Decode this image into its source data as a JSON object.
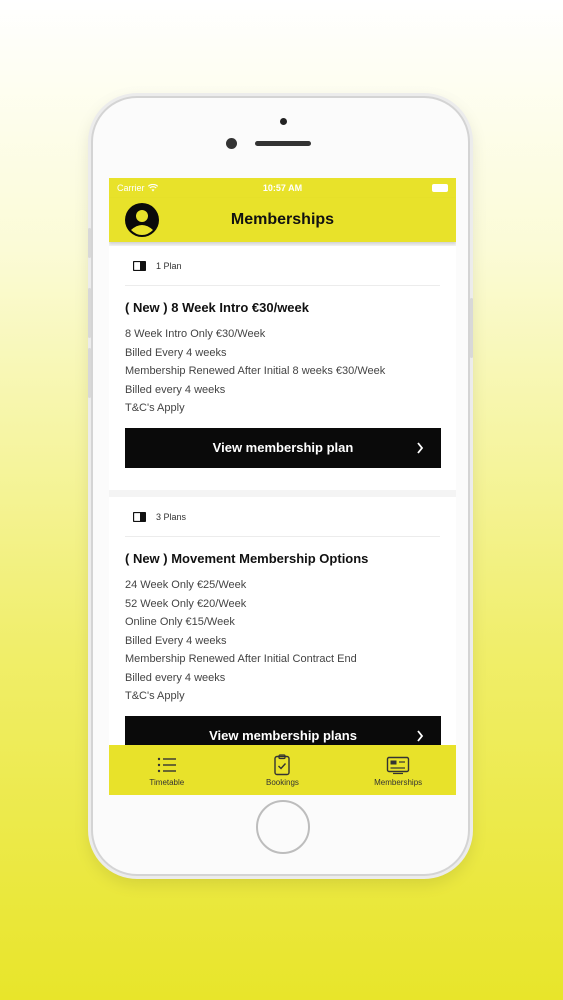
{
  "status_bar": {
    "carrier": "Carrier",
    "time": "10:57 AM"
  },
  "header": {
    "title": "Memberships"
  },
  "cards": [
    {
      "plan_count": "1 Plan",
      "title": "( New ) 8 Week Intro €30/week",
      "lines": [
        "8 Week Intro Only €30/Week",
        "Billed Every 4 weeks",
        "Membership Renewed After Initial 8 weeks €30/Week",
        "Billed every 4 weeks",
        "T&C's Apply"
      ],
      "button_label": "View membership plan"
    },
    {
      "plan_count": "3 Plans",
      "title": "( New ) Movement Membership Options",
      "lines": [
        "24 Week Only €25/Week",
        "52 Week Only €20/Week",
        "Online Only €15/Week",
        "Billed Every 4 weeks",
        "Membership Renewed After Initial Contract End",
        "Billed every 4 weeks",
        "T&C's Apply"
      ],
      "button_label": "View membership plans"
    }
  ],
  "tabs": [
    {
      "label": "Timetable",
      "icon": "list-icon"
    },
    {
      "label": "Bookings",
      "icon": "clipboard-check-icon"
    },
    {
      "label": "Memberships",
      "icon": "membership-card-icon"
    }
  ],
  "colors": {
    "accent": "#e8e22a",
    "button": "#0a0a0a"
  }
}
